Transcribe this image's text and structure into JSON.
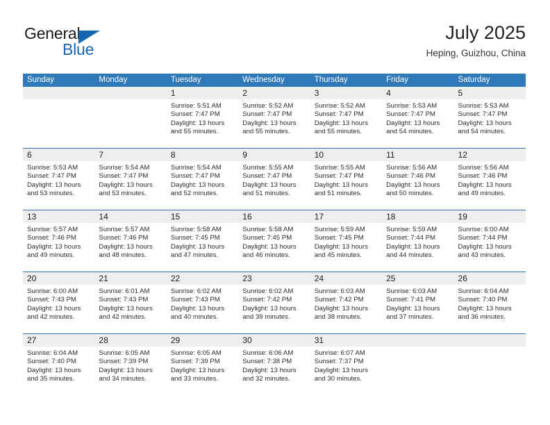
{
  "brand": {
    "name_part1": "General",
    "name_part2": "Blue",
    "triangle_color": "#1565b0"
  },
  "header": {
    "title": "July 2025",
    "location": "Heping, Guizhou, China"
  },
  "calendar": {
    "accent_color": "#3079b8",
    "separator_color": "#2f73ae",
    "daynum_band_color": "#eeeeee",
    "weekday_headers": [
      "Sunday",
      "Monday",
      "Tuesday",
      "Wednesday",
      "Thursday",
      "Friday",
      "Saturday"
    ],
    "weeks": [
      [
        {
          "day": "",
          "sunrise": "",
          "sunset": "",
          "daylight1": "",
          "daylight2": ""
        },
        {
          "day": "",
          "sunrise": "",
          "sunset": "",
          "daylight1": "",
          "daylight2": ""
        },
        {
          "day": "1",
          "sunrise": "Sunrise: 5:51 AM",
          "sunset": "Sunset: 7:47 PM",
          "daylight1": "Daylight: 13 hours",
          "daylight2": "and 55 minutes."
        },
        {
          "day": "2",
          "sunrise": "Sunrise: 5:52 AM",
          "sunset": "Sunset: 7:47 PM",
          "daylight1": "Daylight: 13 hours",
          "daylight2": "and 55 minutes."
        },
        {
          "day": "3",
          "sunrise": "Sunrise: 5:52 AM",
          "sunset": "Sunset: 7:47 PM",
          "daylight1": "Daylight: 13 hours",
          "daylight2": "and 55 minutes."
        },
        {
          "day": "4",
          "sunrise": "Sunrise: 5:53 AM",
          "sunset": "Sunset: 7:47 PM",
          "daylight1": "Daylight: 13 hours",
          "daylight2": "and 54 minutes."
        },
        {
          "day": "5",
          "sunrise": "Sunrise: 5:53 AM",
          "sunset": "Sunset: 7:47 PM",
          "daylight1": "Daylight: 13 hours",
          "daylight2": "and 54 minutes."
        }
      ],
      [
        {
          "day": "6",
          "sunrise": "Sunrise: 5:53 AM",
          "sunset": "Sunset: 7:47 PM",
          "daylight1": "Daylight: 13 hours",
          "daylight2": "and 53 minutes."
        },
        {
          "day": "7",
          "sunrise": "Sunrise: 5:54 AM",
          "sunset": "Sunset: 7:47 PM",
          "daylight1": "Daylight: 13 hours",
          "daylight2": "and 53 minutes."
        },
        {
          "day": "8",
          "sunrise": "Sunrise: 5:54 AM",
          "sunset": "Sunset: 7:47 PM",
          "daylight1": "Daylight: 13 hours",
          "daylight2": "and 52 minutes."
        },
        {
          "day": "9",
          "sunrise": "Sunrise: 5:55 AM",
          "sunset": "Sunset: 7:47 PM",
          "daylight1": "Daylight: 13 hours",
          "daylight2": "and 51 minutes."
        },
        {
          "day": "10",
          "sunrise": "Sunrise: 5:55 AM",
          "sunset": "Sunset: 7:47 PM",
          "daylight1": "Daylight: 13 hours",
          "daylight2": "and 51 minutes."
        },
        {
          "day": "11",
          "sunrise": "Sunrise: 5:56 AM",
          "sunset": "Sunset: 7:46 PM",
          "daylight1": "Daylight: 13 hours",
          "daylight2": "and 50 minutes."
        },
        {
          "day": "12",
          "sunrise": "Sunrise: 5:56 AM",
          "sunset": "Sunset: 7:46 PM",
          "daylight1": "Daylight: 13 hours",
          "daylight2": "and 49 minutes."
        }
      ],
      [
        {
          "day": "13",
          "sunrise": "Sunrise: 5:57 AM",
          "sunset": "Sunset: 7:46 PM",
          "daylight1": "Daylight: 13 hours",
          "daylight2": "and 49 minutes."
        },
        {
          "day": "14",
          "sunrise": "Sunrise: 5:57 AM",
          "sunset": "Sunset: 7:46 PM",
          "daylight1": "Daylight: 13 hours",
          "daylight2": "and 48 minutes."
        },
        {
          "day": "15",
          "sunrise": "Sunrise: 5:58 AM",
          "sunset": "Sunset: 7:45 PM",
          "daylight1": "Daylight: 13 hours",
          "daylight2": "and 47 minutes."
        },
        {
          "day": "16",
          "sunrise": "Sunrise: 5:58 AM",
          "sunset": "Sunset: 7:45 PM",
          "daylight1": "Daylight: 13 hours",
          "daylight2": "and 46 minutes."
        },
        {
          "day": "17",
          "sunrise": "Sunrise: 5:59 AM",
          "sunset": "Sunset: 7:45 PM",
          "daylight1": "Daylight: 13 hours",
          "daylight2": "and 45 minutes."
        },
        {
          "day": "18",
          "sunrise": "Sunrise: 5:59 AM",
          "sunset": "Sunset: 7:44 PM",
          "daylight1": "Daylight: 13 hours",
          "daylight2": "and 44 minutes."
        },
        {
          "day": "19",
          "sunrise": "Sunrise: 6:00 AM",
          "sunset": "Sunset: 7:44 PM",
          "daylight1": "Daylight: 13 hours",
          "daylight2": "and 43 minutes."
        }
      ],
      [
        {
          "day": "20",
          "sunrise": "Sunrise: 6:00 AM",
          "sunset": "Sunset: 7:43 PM",
          "daylight1": "Daylight: 13 hours",
          "daylight2": "and 42 minutes."
        },
        {
          "day": "21",
          "sunrise": "Sunrise: 6:01 AM",
          "sunset": "Sunset: 7:43 PM",
          "daylight1": "Daylight: 13 hours",
          "daylight2": "and 42 minutes."
        },
        {
          "day": "22",
          "sunrise": "Sunrise: 6:02 AM",
          "sunset": "Sunset: 7:43 PM",
          "daylight1": "Daylight: 13 hours",
          "daylight2": "and 40 minutes."
        },
        {
          "day": "23",
          "sunrise": "Sunrise: 6:02 AM",
          "sunset": "Sunset: 7:42 PM",
          "daylight1": "Daylight: 13 hours",
          "daylight2": "and 39 minutes."
        },
        {
          "day": "24",
          "sunrise": "Sunrise: 6:03 AM",
          "sunset": "Sunset: 7:42 PM",
          "daylight1": "Daylight: 13 hours",
          "daylight2": "and 38 minutes."
        },
        {
          "day": "25",
          "sunrise": "Sunrise: 6:03 AM",
          "sunset": "Sunset: 7:41 PM",
          "daylight1": "Daylight: 13 hours",
          "daylight2": "and 37 minutes."
        },
        {
          "day": "26",
          "sunrise": "Sunrise: 6:04 AM",
          "sunset": "Sunset: 7:40 PM",
          "daylight1": "Daylight: 13 hours",
          "daylight2": "and 36 minutes."
        }
      ],
      [
        {
          "day": "27",
          "sunrise": "Sunrise: 6:04 AM",
          "sunset": "Sunset: 7:40 PM",
          "daylight1": "Daylight: 13 hours",
          "daylight2": "and 35 minutes."
        },
        {
          "day": "28",
          "sunrise": "Sunrise: 6:05 AM",
          "sunset": "Sunset: 7:39 PM",
          "daylight1": "Daylight: 13 hours",
          "daylight2": "and 34 minutes."
        },
        {
          "day": "29",
          "sunrise": "Sunrise: 6:05 AM",
          "sunset": "Sunset: 7:39 PM",
          "daylight1": "Daylight: 13 hours",
          "daylight2": "and 33 minutes."
        },
        {
          "day": "30",
          "sunrise": "Sunrise: 6:06 AM",
          "sunset": "Sunset: 7:38 PM",
          "daylight1": "Daylight: 13 hours",
          "daylight2": "and 32 minutes."
        },
        {
          "day": "31",
          "sunrise": "Sunrise: 6:07 AM",
          "sunset": "Sunset: 7:37 PM",
          "daylight1": "Daylight: 13 hours",
          "daylight2": "and 30 minutes."
        },
        {
          "day": "",
          "sunrise": "",
          "sunset": "",
          "daylight1": "",
          "daylight2": ""
        },
        {
          "day": "",
          "sunrise": "",
          "sunset": "",
          "daylight1": "",
          "daylight2": ""
        }
      ]
    ]
  }
}
